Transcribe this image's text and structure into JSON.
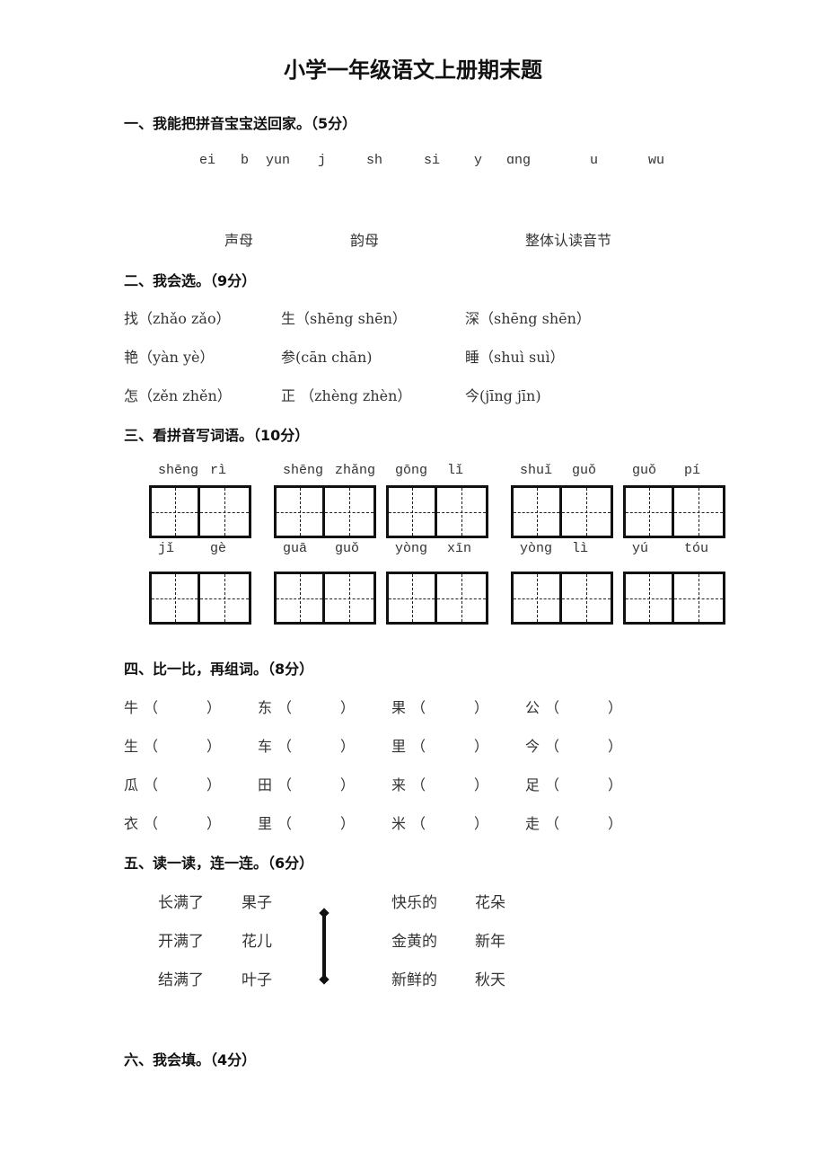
{
  "title": "小学一年级语文上册期末题",
  "sections": {
    "s1": {
      "heading": "一、我能把拼音宝宝送回家。（5分）",
      "pinyin": [
        "ei",
        "b",
        "yun",
        "j",
        "sh",
        "si",
        "y",
        "ɑng",
        "u",
        "wu"
      ],
      "categories": [
        "声母",
        "韵母",
        "整体认读音节"
      ]
    },
    "s2": {
      "heading": "二、我会选。（9分）",
      "rows": [
        [
          "找（zhǎo  zǎo）",
          "生（shēng  shēn）",
          "深（shēng  shēn）"
        ],
        [
          "艳（yàn  yè）",
          "参(cān chān)",
          "睡（shuì suì）"
        ],
        [
          "怎（zěn zhěn）",
          "正 （zhèng  zhèn）",
          "今(jīng  jīn)"
        ]
      ]
    },
    "s3": {
      "heading": "三、看拼音写词语。（10分）",
      "row1": [
        {
          "a": "shēng",
          "b": "rì"
        },
        {
          "a": "shēng",
          "b": "zhǎng"
        },
        {
          "a": "gōng",
          "b": "lǐ"
        },
        {
          "a": "shuǐ",
          "b": "guǒ"
        },
        {
          "a": "guǒ",
          "b": "pí"
        }
      ],
      "row2": [
        {
          "a": "jǐ",
          "b": "gè"
        },
        {
          "a": "guā",
          "b": "guǒ"
        },
        {
          "a": "yòng",
          "b": "xīn"
        },
        {
          "a": "yòng",
          "b": "lì"
        },
        {
          "a": "yú",
          "b": "tóu"
        }
      ]
    },
    "s4": {
      "heading": "四、比一比，再组词。（8分）",
      "open": "（",
      "close": "）",
      "rows": [
        [
          "牛",
          "东",
          "果",
          "公"
        ],
        [
          "生",
          "车",
          "里",
          "今"
        ],
        [
          "瓜",
          "田",
          "来",
          "足"
        ],
        [
          "衣",
          "里",
          "米",
          "走"
        ]
      ]
    },
    "s5": {
      "heading": "五、读一读，连一连。（6分）",
      "left_a": [
        "长满了",
        "开满了",
        "结满了"
      ],
      "left_b": [
        "果子",
        "花儿",
        "叶子"
      ],
      "right_a": [
        "快乐的",
        "金黄的",
        "新鲜的"
      ],
      "right_b": [
        "花朵",
        "新年",
        "秋天"
      ]
    },
    "s6": {
      "heading": "六、我会填。（4分）"
    }
  }
}
